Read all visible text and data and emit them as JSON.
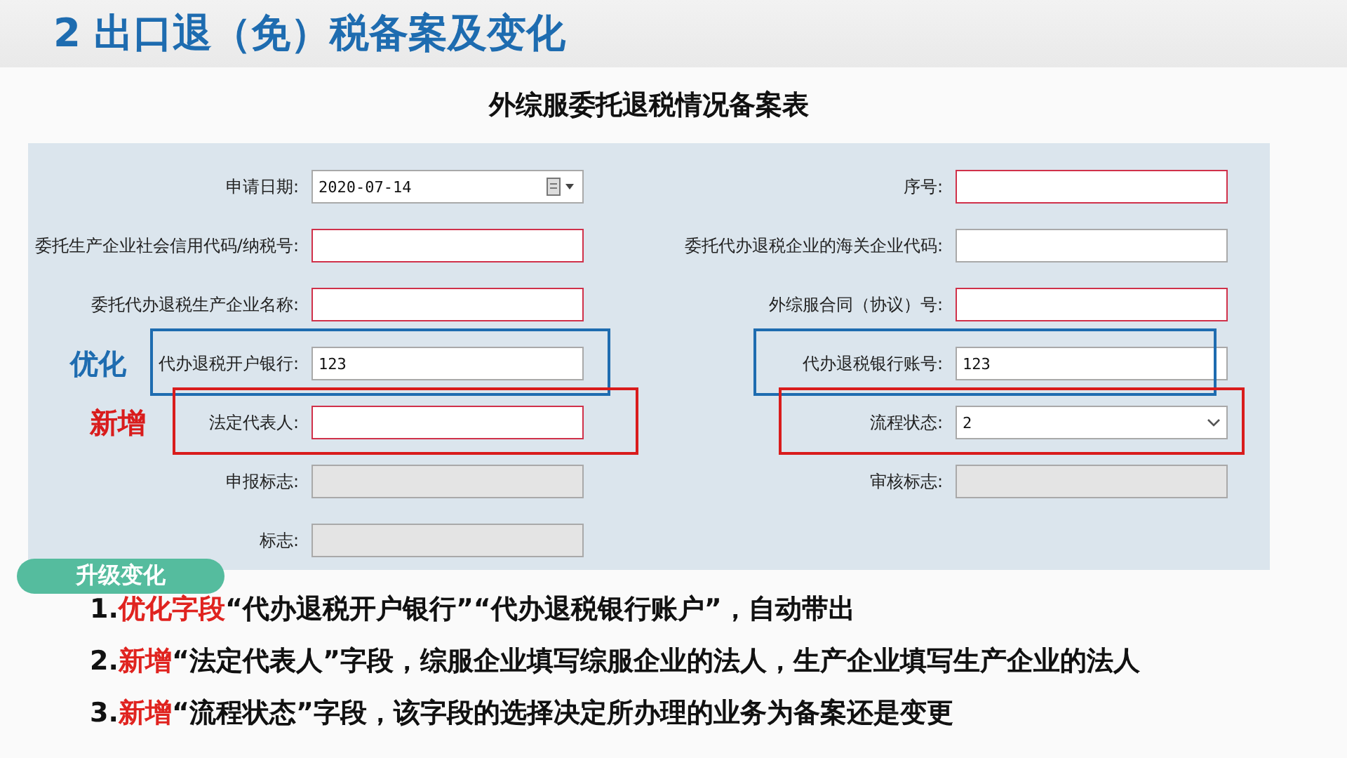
{
  "slide_title": "2 出口退（免）税备案及变化",
  "form": {
    "title": "外综服委托退税情况备案表",
    "rows": [
      {
        "fields": [
          {
            "label": "申请日期:",
            "kind": "date",
            "value": "2020-07-14",
            "required": false,
            "disabled": false
          },
          {
            "label": "序号:",
            "kind": "text",
            "required": true,
            "disabled": false
          }
        ]
      },
      {
        "fields": [
          {
            "label": "委托生产企业社会信用代码/纳税号:",
            "kind": "text",
            "required": true,
            "disabled": false
          },
          {
            "label": "委托代办退税企业的海关企业代码:",
            "kind": "text",
            "required": false,
            "disabled": false
          }
        ]
      },
      {
        "fields": [
          {
            "label": "委托代办退税生产企业名称:",
            "kind": "text",
            "required": true,
            "disabled": false
          },
          {
            "label": "外综服合同（协议）号:",
            "kind": "text",
            "required": true,
            "disabled": false
          }
        ]
      },
      {
        "tag": {
          "text": "优化",
          "kind": "optimized"
        },
        "fields": [
          {
            "label": "代办退税开户银行:",
            "kind": "text",
            "value": "123",
            "required": false,
            "disabled": false,
            "color": "#1e6cb0"
          },
          {
            "label": "代办退税银行账号:",
            "kind": "text",
            "value": "123",
            "required": false,
            "disabled": false,
            "color": "#1e6cb0"
          }
        ]
      },
      {
        "tag": {
          "text": "新增",
          "kind": "new"
        },
        "fields": [
          {
            "label": "法定代表人:",
            "kind": "text",
            "required": true,
            "disabled": false,
            "color": "#d91c1c"
          },
          {
            "label": "流程状态:",
            "kind": "select",
            "value": "2",
            "required": false,
            "disabled": false,
            "color": "#d91c1c"
          }
        ]
      },
      {
        "fields": [
          {
            "label": "申报标志:",
            "kind": "text",
            "required": false,
            "disabled": true
          },
          {
            "label": "审核标志:",
            "kind": "text",
            "required": false,
            "disabled": true
          }
        ]
      },
      {
        "fields": [
          {
            "label": "标志:",
            "kind": "text",
            "required": false,
            "disabled": true
          }
        ]
      }
    ]
  },
  "changes": {
    "heading": "升级变化",
    "items": [
      [
        {
          "text": "1.",
          "kind": "plain"
        },
        {
          "text": "优化字段",
          "kind": "emphasis"
        },
        {
          "text": "“代办退税开户银行”“代办退税银行账户”，自动带出",
          "kind": "plain"
        }
      ],
      [
        {
          "text": "2.",
          "kind": "plain"
        },
        {
          "text": "新增",
          "kind": "emphasis"
        },
        {
          "text": "“法定代表人”字段，综服企业填写综服企业的法人，生产企业填写生产企业的法人",
          "kind": "plain"
        }
      ],
      [
        {
          "text": "3.",
          "kind": "plain"
        },
        {
          "text": "新增",
          "kind": "emphasis"
        },
        {
          "text": "“流程状态”字段，该字段的选择决定所办理的业务为备案还是变更",
          "kind": "plain"
        }
      ]
    ]
  }
}
